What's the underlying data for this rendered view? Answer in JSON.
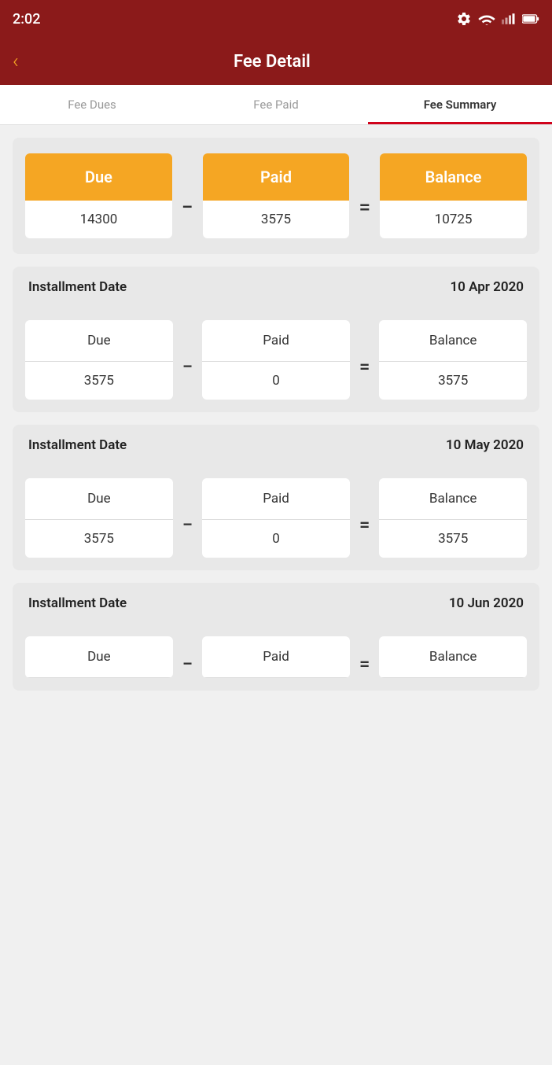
{
  "statusBar": {
    "time": "2:02",
    "settingsIcon": "gear-icon"
  },
  "header": {
    "title": "Fee Detail",
    "backLabel": "‹"
  },
  "tabs": [
    {
      "label": "Fee Dues",
      "active": false
    },
    {
      "label": "Fee Paid",
      "active": false
    },
    {
      "label": "Fee Summary",
      "active": true
    }
  ],
  "summary": {
    "due": {
      "label": "Due",
      "value": "14300"
    },
    "paid": {
      "label": "Paid",
      "value": "3575"
    },
    "balance": {
      "label": "Balance",
      "value": "10725"
    }
  },
  "installments": [
    {
      "label": "Installment Date",
      "date": "10 Apr 2020",
      "due": "3575",
      "paid": "0",
      "balance": "3575"
    },
    {
      "label": "Installment Date",
      "date": "10 May 2020",
      "due": "3575",
      "paid": "0",
      "balance": "3575"
    },
    {
      "label": "Installment Date",
      "date": "10 Jun 2020",
      "due": null,
      "paid": null,
      "balance": null
    }
  ],
  "operators": {
    "minus": "−",
    "equals": "="
  }
}
